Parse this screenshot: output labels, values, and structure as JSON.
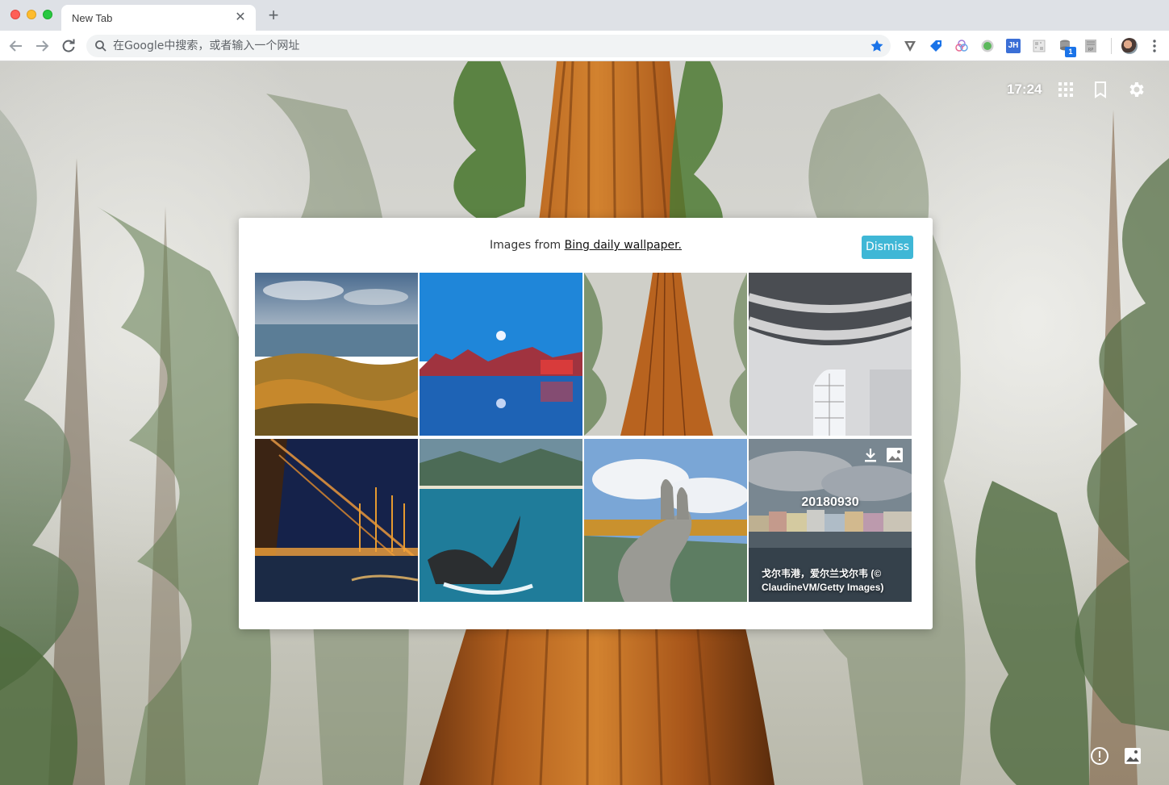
{
  "browser": {
    "tab_title": "New Tab",
    "tab_close": "✕",
    "new_tab": "+",
    "omnibox_placeholder": "在Google中搜索，或者输入一个网址",
    "extension_badge": "1",
    "extension_jh_label": "JH",
    "extensions": [
      "vivaldi-icon",
      "tag-icon",
      "palette-icon",
      "green-circle-icon",
      "jh-icon",
      "qr-icon",
      "stack-icon",
      "rp-icon"
    ]
  },
  "overlay": {
    "clock": "17:24",
    "icons": [
      "apps-grid-icon",
      "bookmark-icon",
      "settings-icon"
    ]
  },
  "dialog": {
    "message_prefix": "Images from ",
    "message_link": "Bing daily wallpaper.",
    "dismiss_label": "Dismiss",
    "thumbnails": [
      {
        "name": "mountain-valley-autumn"
      },
      {
        "name": "night-water-town-moon"
      },
      {
        "name": "redwood-trunk"
      },
      {
        "name": "white-ceiling-sculpture"
      },
      {
        "name": "harbor-cranes-night"
      },
      {
        "name": "whale-tail"
      },
      {
        "name": "golden-bridge-hands"
      },
      {
        "name": "galway-harbour",
        "date": "20180930",
        "caption": "戈尔韦港，爱尔兰戈尔韦 (© ClaudineVM/Getty Images)"
      }
    ]
  },
  "bottom_icons": [
    "info-icon",
    "image-icon"
  ],
  "colors": {
    "accent": "#3fb7d6",
    "star": "#1a73e8",
    "tab_strip": "#dee1e6"
  }
}
